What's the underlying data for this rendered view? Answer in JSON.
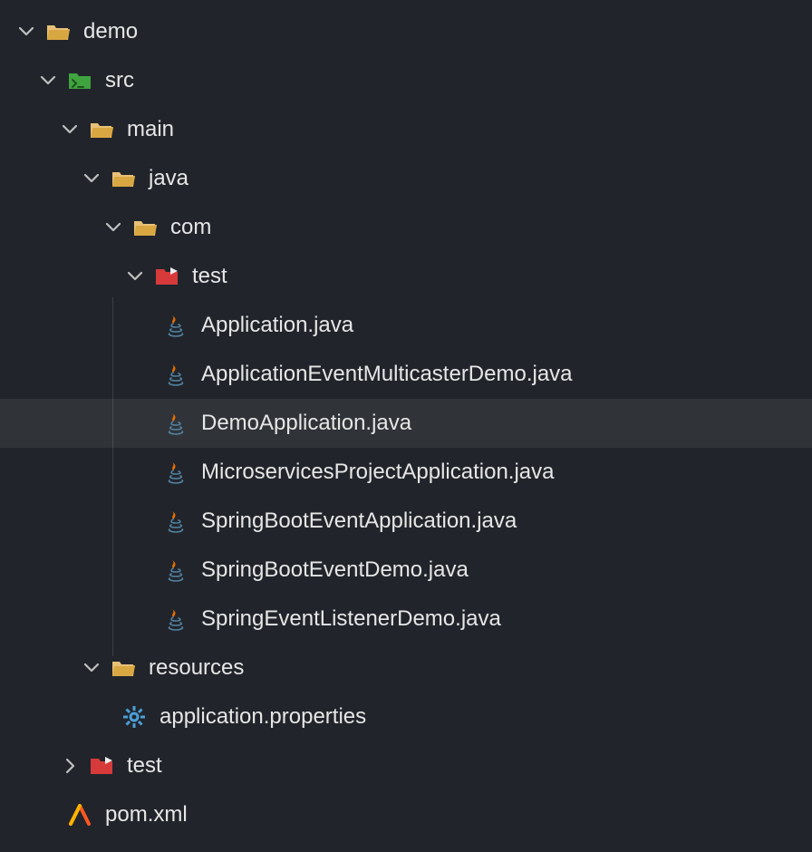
{
  "tree": {
    "demo": "demo",
    "src": "src",
    "main": "main",
    "java": "java",
    "com": "com",
    "test": "test",
    "files": {
      "application": "Application.java",
      "eventMulticaster": "ApplicationEventMulticasterDemo.java",
      "demoApplication": "DemoApplication.java",
      "microservices": "MicroservicesProjectApplication.java",
      "springBootEventApp": "SpringBootEventApplication.java",
      "springBootEventDemo": "SpringBootEventDemo.java",
      "springEventListener": "SpringEventListenerDemo.java"
    },
    "resources": "resources",
    "appProperties": "application.properties",
    "testFolder": "test",
    "pom": "pom.xml"
  }
}
